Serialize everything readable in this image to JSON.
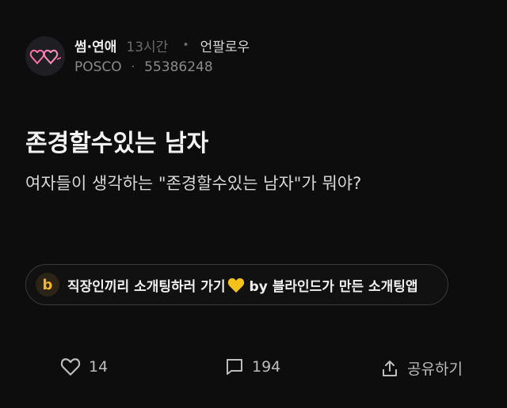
{
  "post": {
    "channel": "썸·연애",
    "time_ago": "13시간",
    "follow_label": "언팔로우",
    "company": "POSCO",
    "author_id": "55386248",
    "title": "존경할수있는 남자",
    "body": "여자들이 생각하는 \"존경할수있는 남자\"가 뭐야?"
  },
  "ad": {
    "logo_letter": "b",
    "text_before": "직장인끼리 소개팅하러 가기",
    "text_after": "by 블라인드가 만든 소개팅앱",
    "icon": "yellow-heart-icon",
    "accent_color": "#f0b72a"
  },
  "actions": {
    "like_count": "14",
    "comment_count": "194",
    "share_label": "공유하기"
  },
  "avatar": {
    "icon": "pink-neon-hearts-icon",
    "color": "#ff7bb0"
  }
}
